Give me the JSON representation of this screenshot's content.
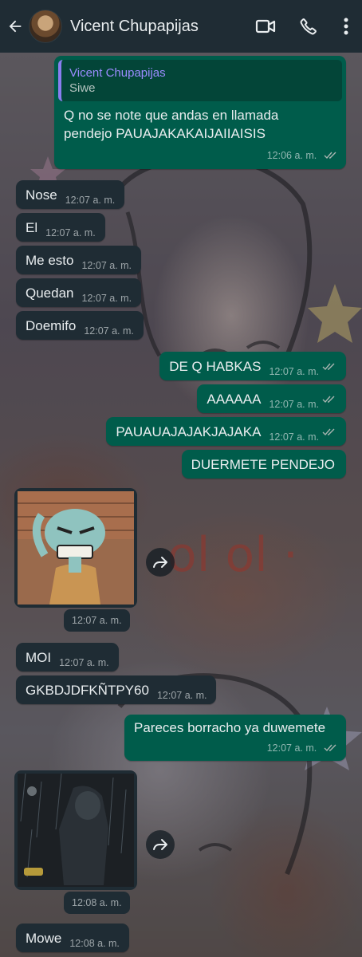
{
  "header": {
    "contact_name": "Vicent Chupapijas"
  },
  "messages": [
    {
      "direction": "out",
      "reply": {
        "name": "Vicent Chupapijas",
        "text": "Siwe"
      },
      "text_lines": [
        "Q no se note que andas en llamada",
        "pendejo PAUAJAKAKAIJAIIAISIS"
      ],
      "time": "12:06 a. m."
    },
    {
      "direction": "in",
      "text": "Nose",
      "time": "12:07 a. m."
    },
    {
      "direction": "in",
      "text": "El",
      "time": "12:07 a. m."
    },
    {
      "direction": "in",
      "text": "Me esto",
      "time": "12:07 a. m."
    },
    {
      "direction": "in",
      "text": "Quedan",
      "time": "12:07 a. m."
    },
    {
      "direction": "in",
      "text": "Doemifo",
      "time": "12:07 a. m."
    },
    {
      "direction": "out",
      "text": "DE Q HABKAS",
      "time": "12:07 a. m."
    },
    {
      "direction": "out",
      "text": "AAAAAA",
      "time": "12:07 a. m."
    },
    {
      "direction": "out",
      "text": "PAUAUAJAJAKJAJAKA",
      "time": "12:07 a. m."
    },
    {
      "direction": "out",
      "text": "DUERMETE PENDEJO",
      "time": ""
    },
    {
      "direction": "in",
      "type": "image",
      "image": "angry-squidward-sticker",
      "time": "12:07 a. m."
    },
    {
      "direction": "in",
      "text": "MOI",
      "time": "12:07 a. m."
    },
    {
      "direction": "in",
      "text": "GKBDJDFKÑTPY60",
      "time": "12:07 a. m."
    },
    {
      "direction": "out",
      "text": "Pareces borracho ya duwemete",
      "time": "12:07 a. m."
    },
    {
      "direction": "in",
      "type": "image",
      "image": "dark-rainy-hooded-figure",
      "time": "12:08 a. m."
    },
    {
      "direction": "in",
      "text": "Mowe",
      "time": "12:08 a. m."
    }
  ],
  "colors": {
    "header_bg": "#1f2c34",
    "incoming_bubble": "#1f2c34",
    "outgoing_bubble": "#005c4b",
    "reply_name": "#9b8cff",
    "read_ticks": "#a8b4b0"
  },
  "icons": [
    "back-arrow-icon",
    "video-call-icon",
    "phone-icon",
    "more-vert-icon",
    "double-check-icon",
    "forward-icon"
  ]
}
